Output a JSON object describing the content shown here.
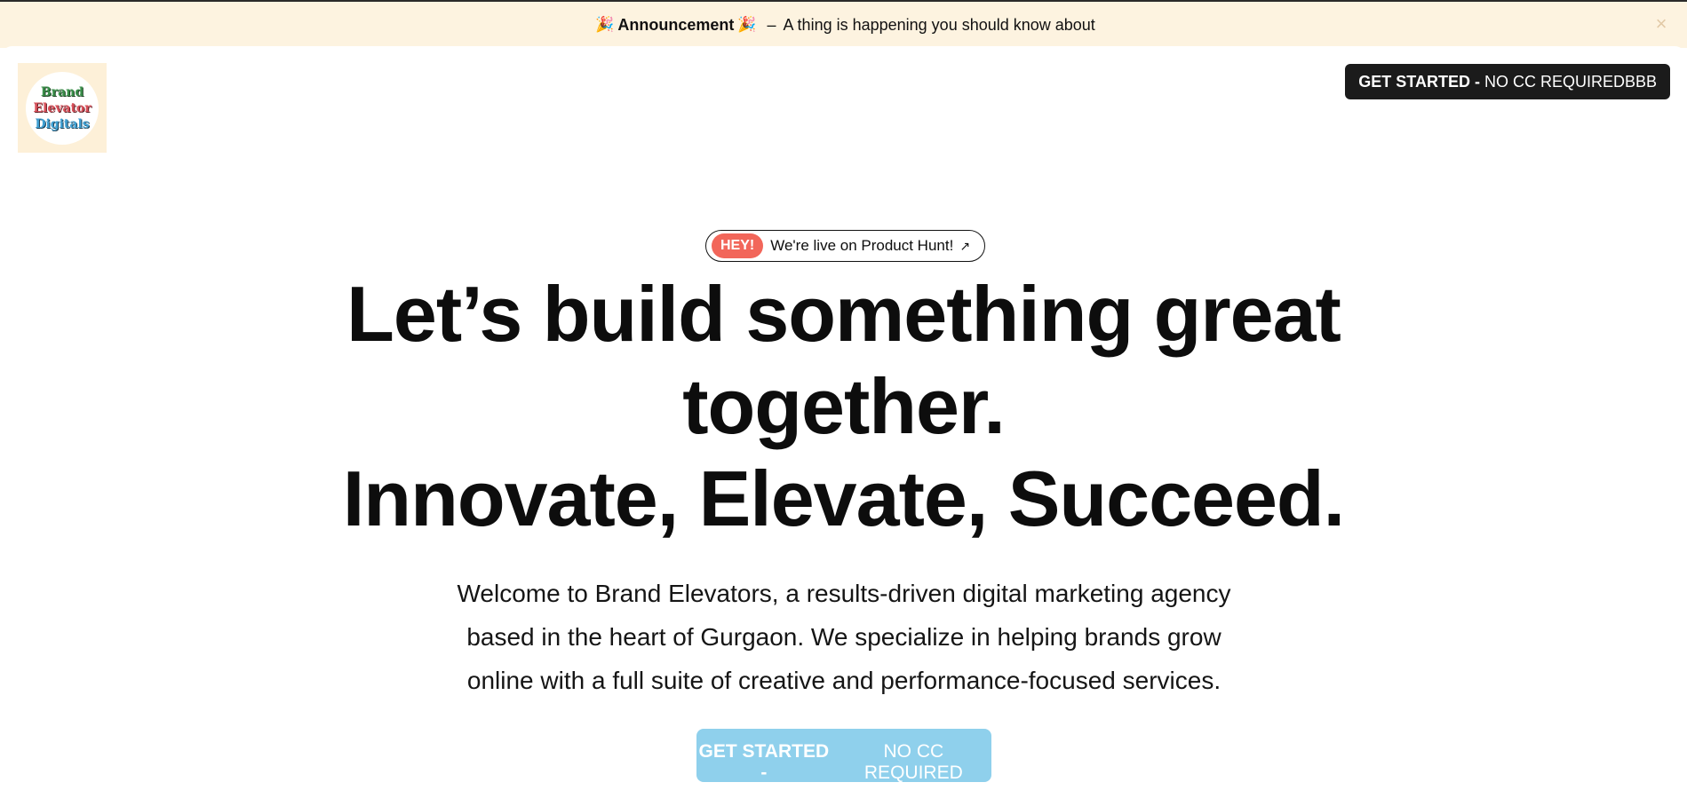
{
  "announcement": {
    "emoji_left": "🎉",
    "label": "Announcement",
    "emoji_right": "🎉",
    "separator": "–",
    "message": "A thing is happening you should know about",
    "close_icon": "×"
  },
  "logo": {
    "line1": "Brand",
    "line2": "Elevator",
    "line3": "Digitals"
  },
  "header": {
    "cta_bold": "GET STARTED -",
    "cta_rest": "NO CC REQUIREDBBB"
  },
  "product_hunt": {
    "badge": "HEY!",
    "text": "We're live on Product Hunt!",
    "arrow_icon": "↗"
  },
  "hero": {
    "line1": "Let’s build something great",
    "line2": "together.",
    "line3": "Innovate, Elevate, Succeed."
  },
  "subtext": {
    "line1": "Welcome to Brand Elevators, a results-driven digital marketing agency",
    "line2": "based in the heart of Gurgaon. We specialize in helping brands grow",
    "line3": "online with a full suite of creative and performance-focused services."
  },
  "hero_cta": {
    "bold": "GET STARTED -",
    "rest": "NO CC REQUIRED"
  },
  "colors": {
    "announcement_bg": "#fdf3e0",
    "hey_badge": "#f2665a",
    "hero_cta_bg": "#8fd0ec",
    "top_cta_bg": "#1b1b1b"
  }
}
